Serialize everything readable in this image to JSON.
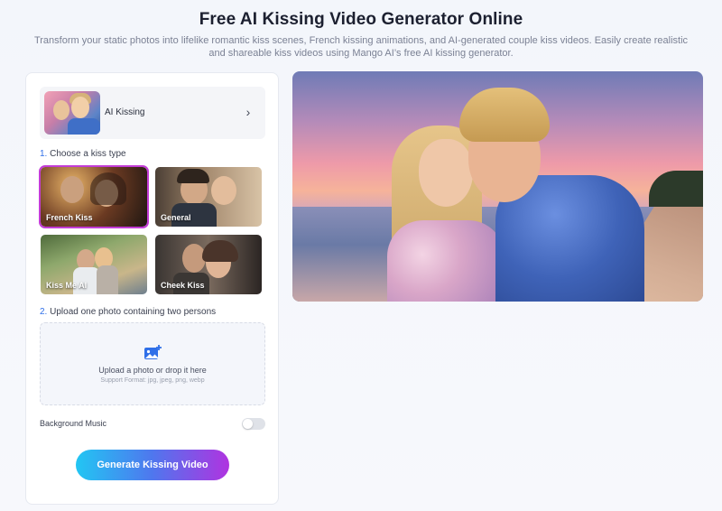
{
  "header": {
    "title": "Free AI Kissing Video Generator Online",
    "subtitle": "Transform your static photos into lifelike romantic kiss scenes, French kissing animations, and AI-generated couple kiss videos. Easily create realistic and shareable kiss videos using Mango AI’s free AI kissing generator."
  },
  "model_selector": {
    "label": "AI Kissing",
    "chevron_icon": "chevron-right-icon"
  },
  "step1": {
    "number": "1.",
    "label": "Choose a kiss type",
    "options": [
      {
        "label": "French Kiss",
        "selected": true
      },
      {
        "label": "General",
        "selected": false
      },
      {
        "label": "Kiss Me AI",
        "selected": false
      },
      {
        "label": "Cheek Kiss",
        "selected": false
      }
    ]
  },
  "step2": {
    "number": "2.",
    "label": "Upload one photo containing two persons",
    "upload_text": "Upload a photo or drop it here",
    "upload_hint": "Support Format: jpg, jpeg, png, webp",
    "upload_icon": "image-add-icon"
  },
  "background_music": {
    "label": "Background Music",
    "enabled": false
  },
  "generate_button": {
    "label": "Generate Kissing Video"
  },
  "colors": {
    "accent_blue": "#2f6fe8",
    "selected_outline": "#c33cd6",
    "button_gradient_start": "#22c6f3",
    "button_gradient_end": "#b033e0"
  }
}
